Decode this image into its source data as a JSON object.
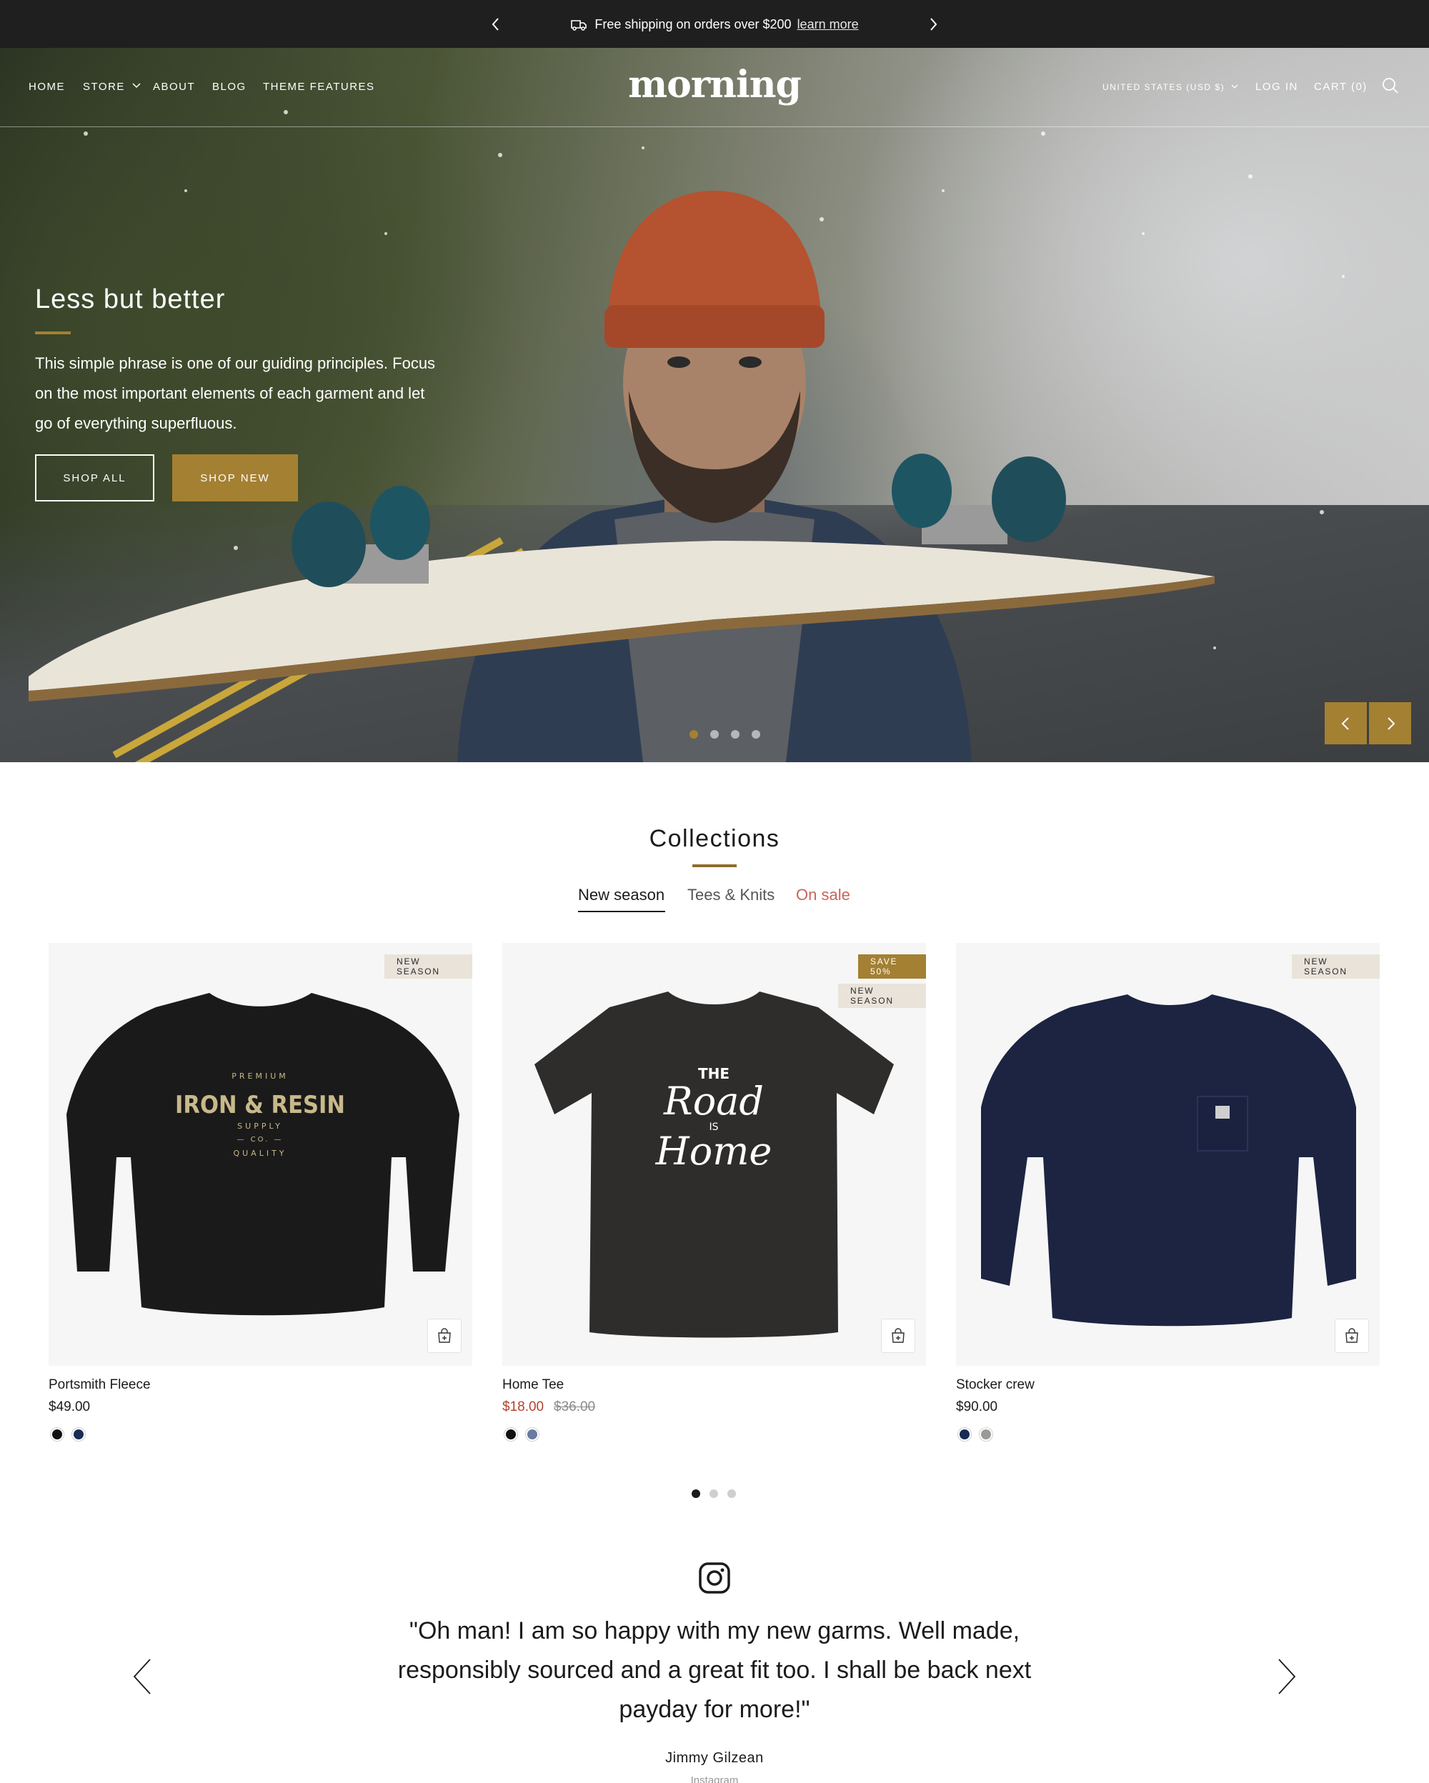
{
  "announcement": {
    "message": "Free shipping on orders over $200",
    "link": "learn more"
  },
  "nav": {
    "left": [
      "HOME",
      "STORE",
      "ABOUT",
      "BLOG",
      "THEME FEATURES"
    ],
    "logo": "morning",
    "currency": "UNITED STATES (USD $)",
    "login": "LOG IN",
    "cart": "CART (0)"
  },
  "hero": {
    "title": "Less but better",
    "text": "This simple phrase is one of our guiding principles. Focus on the most important elements of each garment and let go of everything superfluous.",
    "buttons": [
      "SHOP ALL",
      "SHOP NEW"
    ],
    "slides": 4,
    "active_slide": 1
  },
  "collections": {
    "title": "Collections",
    "tabs": [
      "New season",
      "Tees & Knits",
      "On sale"
    ],
    "active_tab": "New season",
    "products": [
      {
        "name": "Portsmith Fleece",
        "price": "$49.00",
        "badges": [
          "NEW SEASON"
        ],
        "swatches": [
          "#111111",
          "#1a2a55"
        ]
      },
      {
        "name": "Home Tee",
        "price": "$18.00",
        "compare_price": "$36.00",
        "badges": [
          "SAVE 50%",
          "NEW SEASON"
        ],
        "swatches": [
          "#111111",
          "#6a7aa0"
        ]
      },
      {
        "name": "Stocker crew",
        "price": "$90.00",
        "badges": [
          "NEW SEASON"
        ],
        "swatches": [
          "#1a2a55",
          "#9a9a96"
        ]
      }
    ],
    "pages": 3,
    "active_page": 1
  },
  "testimonial": {
    "quote": "\"Oh man! I am so happy with my new garms. Well made, responsibly sourced and a great fit too. I shall be back next payday for more!\"",
    "author": "Jimmy Gilzean",
    "source": "Instagram"
  },
  "colors": {
    "accent": "#a48033",
    "sale": "#b3402f",
    "dark_bar": "#1f1f1f"
  }
}
